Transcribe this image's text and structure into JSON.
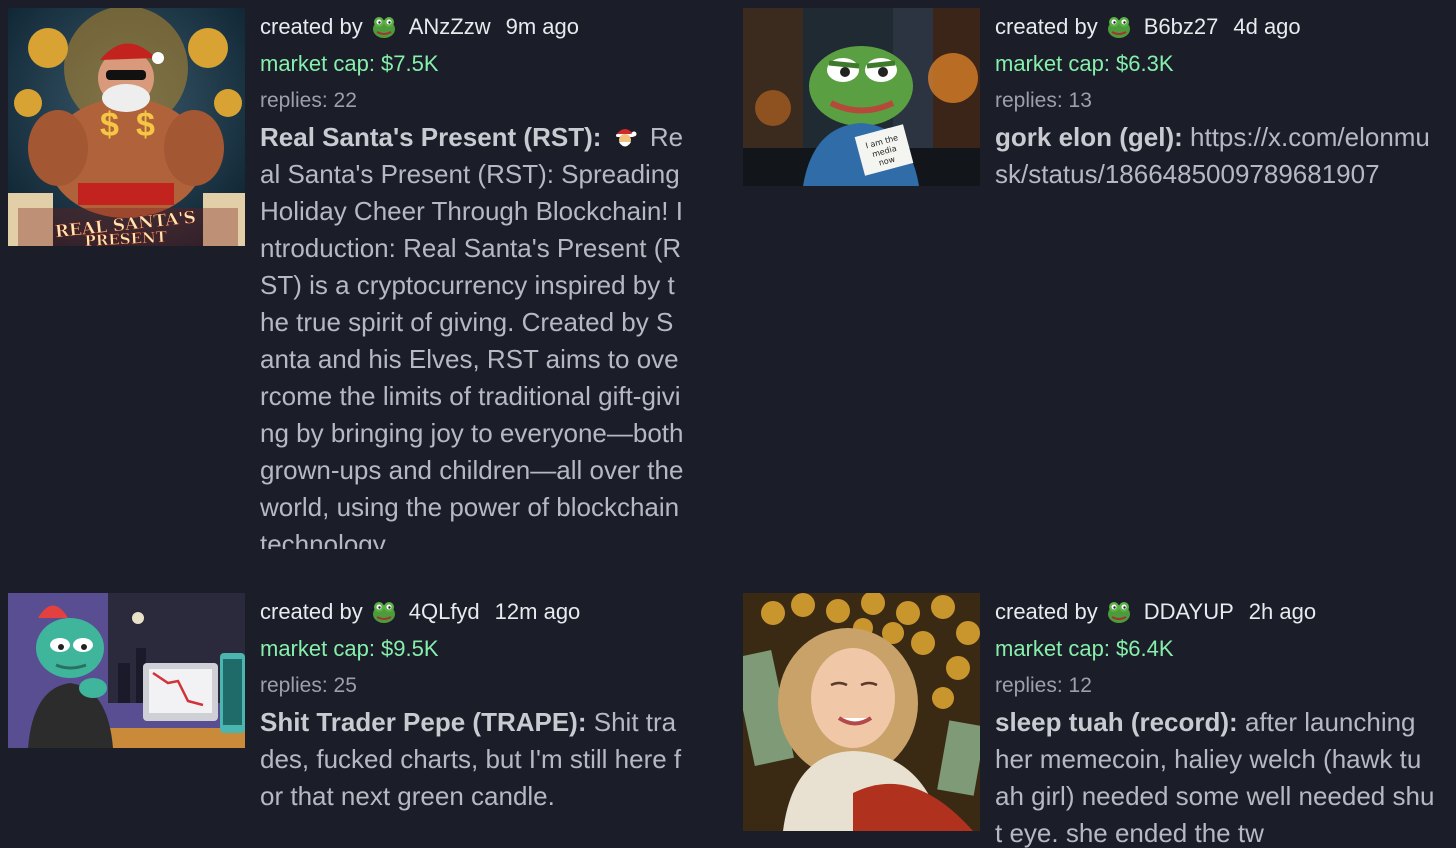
{
  "common": {
    "created_by": "created by",
    "market_cap_prefix": "market cap: ",
    "replies_prefix": "replies: "
  },
  "cards": [
    {
      "creator": "ANzZzw",
      "age": "9m ago",
      "market_cap": "$7.5K",
      "replies": "22",
      "name": "Real Santa's Present (RST):",
      "description": "Real Santa's Present (RST): Spreading Holiday Cheer Through Blockchain! Introduction: Real Santa's Present (RST) is a cryptocurrency inspired by the true spirit of giving. Created by Santa and his Elves, RST aims to overcome the limits of traditional gift-giving by bringing joy to everyone—both grown-ups and children—all over the world, using the power of blockchain technology.",
      "image_label": "REAL SANTA'S PRESENT",
      "image_icon": "santa-emoji"
    },
    {
      "creator": "B6bz27",
      "age": "4d ago",
      "market_cap": "$6.3K",
      "replies": "13",
      "name": "gork elon (gel):",
      "description": "https://x.com/elonmusk/status/1866485009789681907",
      "image_label": "I am the media now"
    },
    {
      "creator": "4QLfyd",
      "age": "12m ago",
      "market_cap": "$9.5K",
      "replies": "25",
      "name": "Shit Trader Pepe (TRAPE):",
      "description": "Shit trades, fucked charts, but I'm still here for that next green candle."
    },
    {
      "creator": "DDAYUP",
      "age": "2h ago",
      "market_cap": "$6.4K",
      "replies": "12",
      "name": "sleep tuah (record):",
      "description": "after launching her memecoin, haliey welch (hawk tuah girl) needed some well needed shut eye. she ended the tw"
    }
  ],
  "colors": {
    "background": "#1b1d28",
    "market_cap": "#86efac",
    "text": "#e9eaee",
    "muted": "#9ca0aa",
    "description": "#b6b9c1"
  }
}
